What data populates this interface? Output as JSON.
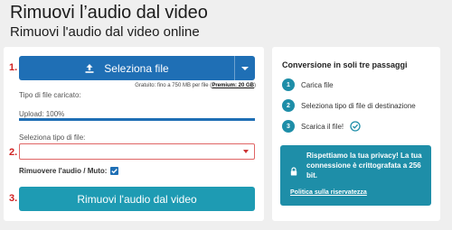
{
  "header": {
    "title": "Rimuovi l’audio dal video",
    "subtitle": "Rimuovi l'audio dal video online"
  },
  "form": {
    "step_markers": [
      "1.",
      "2.",
      "3."
    ],
    "select_file_label": "Seleziona file",
    "limits_prefix": "Gratuito: fino a 750 MB per file (",
    "limits_premium": "Premium: 20 GB",
    "limits_suffix": ")",
    "uploaded_type_label": "Tipo di file caricato:",
    "upload_status": "Upload: 100%",
    "upload_progress": 1.0,
    "select_type_label": "Seleziona tipo di file:",
    "select_type_value": "",
    "mute_label": "Rimuovere l'audio / Muto:",
    "mute_checked": true,
    "submit_label": "Rimuovi l'audio dal video"
  },
  "steps": {
    "title": "Conversione in soli tre passaggi",
    "items": [
      {
        "num": "1",
        "label": "Carica file"
      },
      {
        "num": "2",
        "label": "Seleziona tipo di file di destinazione"
      },
      {
        "num": "3",
        "label": "Scarica il file!"
      }
    ]
  },
  "privacy": {
    "text": "Rispettiamo la tua privacy! La tua connessione è crittografata a 256 bit.",
    "link": "Politica sulla riservatezza"
  },
  "colors": {
    "primary_blue": "#1f6fb5",
    "teal": "#1e8ea8",
    "step_red": "#d02020"
  }
}
